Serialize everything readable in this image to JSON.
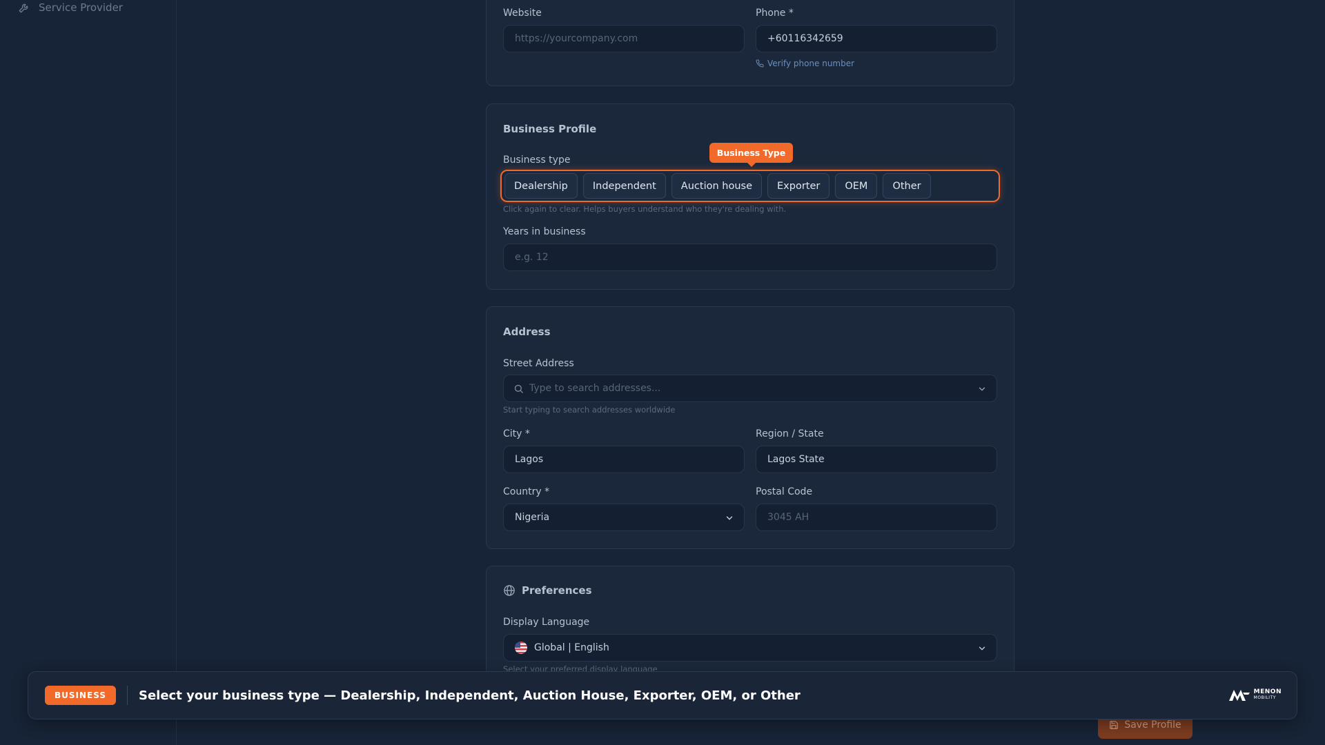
{
  "sidebar": {
    "items": [
      {
        "label": "Service Provider",
        "icon": "wrench-icon"
      }
    ]
  },
  "contact": {
    "website_label": "Website",
    "website_placeholder": "https://yourcompany.com",
    "phone_label": "Phone *",
    "phone_value": "+60116342659",
    "verify_phone": "Verify phone number"
  },
  "business_profile": {
    "title": "Business Profile",
    "business_type_label": "Business type",
    "tooltip": "Business Type",
    "types": [
      "Dealership",
      "Independent",
      "Auction house",
      "Exporter",
      "OEM",
      "Other"
    ],
    "business_type_hint": "Click again to clear. Helps buyers understand who they're dealing with.",
    "years_label": "Years in business",
    "years_placeholder": "e.g. 12"
  },
  "address": {
    "title": "Address",
    "street_label": "Street Address",
    "street_placeholder": "Type to search addresses...",
    "street_hint": "Start typing to search addresses worldwide",
    "city_label": "City *",
    "city_value": "Lagos",
    "region_label": "Region / State",
    "region_value": "Lagos State",
    "country_label": "Country *",
    "country_value": "Nigeria",
    "postal_label": "Postal Code",
    "postal_placeholder": "3045 AH"
  },
  "preferences": {
    "title": "Preferences",
    "language_label": "Display Language",
    "language_value": "Global | English",
    "language_hint": "Select your preferred display language"
  },
  "banner": {
    "badge": "BUSINESS",
    "text": "Select your business type — Dealership, Independent, Auction House, Exporter, OEM, or Other",
    "logo_line1": "MENON",
    "logo_line2": "MOBILITY"
  },
  "actions": {
    "save_label": "Save Profile"
  },
  "colors": {
    "accent": "#f26a2a",
    "background": "#172336",
    "card": "#1b283c"
  }
}
